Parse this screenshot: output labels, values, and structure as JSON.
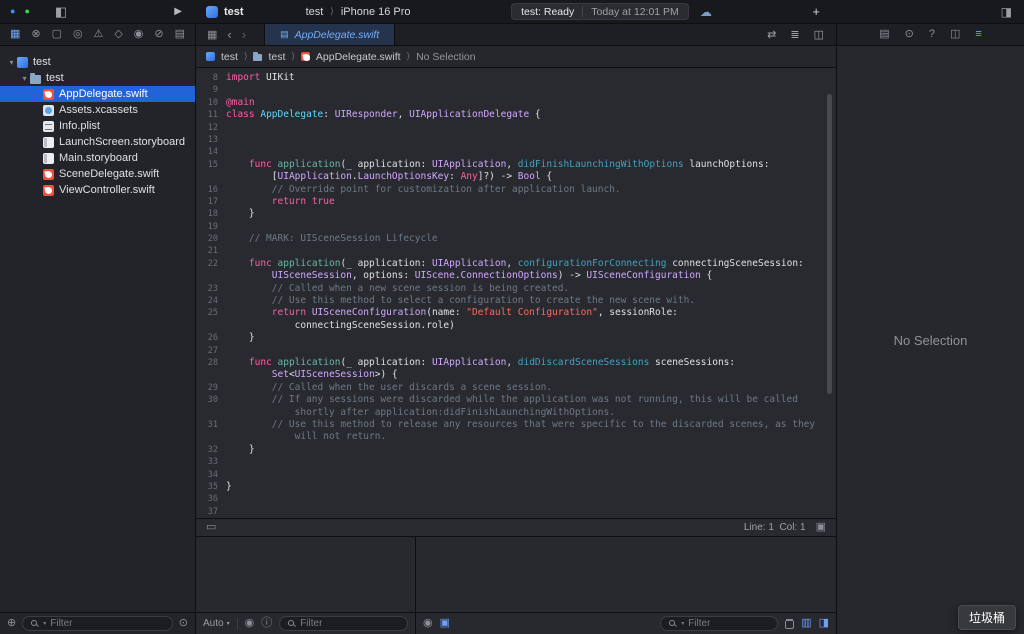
{
  "icons": {
    "dot_blue": "●",
    "dot_green": "●",
    "sidebar_toggle": "◧",
    "play": "▶",
    "chevron": "⟩",
    "back": "‹",
    "forward": "›",
    "grid": "▦",
    "doc": "▤",
    "swap": "⇄",
    "list_lines": "≣",
    "split_editor": "◫",
    "cloud": "☁",
    "plus": "+",
    "panel_right": "◨",
    "plus_circle": "⊕",
    "recent_clock": "⊙",
    "eye": "◉",
    "info": "ⓘ",
    "console_icon": "▣",
    "panel_bottom": "▥",
    "panel_side": "◨",
    "dropdown_arrow": "▾",
    "statusbar_left": "▭",
    "statusbar_right": "▣",
    "disclosure_open": "▾"
  },
  "titlebar": {
    "app_indicator": "test",
    "scheme_project": "test",
    "scheme_device": "iPhone 16 Pro",
    "status_primary": "test: Ready",
    "status_secondary": "Today at 12:01 PM"
  },
  "navigator_strip": [
    {
      "name": "project-navigator",
      "glyph": "▦",
      "active": true
    },
    {
      "name": "source-control-navigator",
      "glyph": "⊗",
      "active": false
    },
    {
      "name": "bookmarks-navigator",
      "glyph": "▢",
      "active": false
    },
    {
      "name": "find-navigator",
      "glyph": "◎",
      "active": false
    },
    {
      "name": "issues-navigator",
      "glyph": "⚠",
      "active": false
    },
    {
      "name": "tests-navigator",
      "glyph": "◇",
      "active": false
    },
    {
      "name": "debug-navigator",
      "glyph": "◉",
      "active": false
    },
    {
      "name": "breakpoints-navigator",
      "glyph": "⊘",
      "active": false
    },
    {
      "name": "reports-navigator",
      "glyph": "▤",
      "active": false
    }
  ],
  "inspector_strip": [
    {
      "name": "file-inspector",
      "glyph": "▤",
      "active": false
    },
    {
      "name": "history-inspector",
      "glyph": "⊙",
      "active": false
    },
    {
      "name": "quick-help-inspector",
      "glyph": "?",
      "active": false
    },
    {
      "name": "accessibility-inspector",
      "glyph": "◫",
      "active": false
    },
    {
      "name": "attributes-inspector",
      "glyph": "≡",
      "active": true
    }
  ],
  "navigator": {
    "filter_placeholder": "Filter",
    "items": [
      {
        "label": "test",
        "type": "project",
        "level": 0,
        "expanded": true,
        "selected": false
      },
      {
        "label": "test",
        "type": "folder",
        "level": 1,
        "expanded": true,
        "selected": false
      },
      {
        "label": "AppDelegate.swift",
        "type": "swift",
        "level": 2,
        "selected": true
      },
      {
        "label": "Assets.xcassets",
        "type": "assets",
        "level": 2,
        "selected": false
      },
      {
        "label": "Info.plist",
        "type": "plist",
        "level": 2,
        "selected": false
      },
      {
        "label": "LaunchScreen.storyboard",
        "type": "storyboard",
        "level": 2,
        "selected": false
      },
      {
        "label": "Main.storyboard",
        "type": "storyboard",
        "level": 2,
        "selected": false
      },
      {
        "label": "SceneDelegate.swift",
        "type": "swift",
        "level": 2,
        "selected": false
      },
      {
        "label": "ViewController.swift",
        "type": "swift",
        "level": 2,
        "selected": false
      }
    ]
  },
  "editor": {
    "tab_label": "AppDelegate.swift",
    "breadcrumb": [
      {
        "label": "test",
        "icon": "project",
        "dim": false
      },
      {
        "label": "test",
        "icon": "folder",
        "dim": false
      },
      {
        "label": "AppDelegate.swift",
        "icon": "swift",
        "dim": false
      },
      {
        "label": "No Selection",
        "icon": "",
        "dim": true
      }
    ],
    "statusbar_text": "Line: 1  Col: 1",
    "lines": [
      {
        "num": "8",
        "indent": 0,
        "segs": [
          [
            "k",
            "import"
          ],
          [
            "p",
            " UIKit"
          ]
        ]
      },
      {
        "num": "9",
        "indent": 0,
        "segs": []
      },
      {
        "num": "10",
        "indent": 0,
        "segs": [
          [
            "k",
            "@main"
          ]
        ]
      },
      {
        "num": "11",
        "indent": 0,
        "segs": [
          [
            "k",
            "class"
          ],
          [
            "p",
            " "
          ],
          [
            "d",
            "AppDelegate"
          ],
          [
            "p",
            ": "
          ],
          [
            "t",
            "UIResponder"
          ],
          [
            "p",
            ", "
          ],
          [
            "t",
            "UIApplicationDelegate"
          ],
          [
            "p",
            " {"
          ]
        ]
      },
      {
        "num": "12",
        "indent": 0,
        "segs": []
      },
      {
        "num": "13",
        "indent": 0,
        "segs": []
      },
      {
        "num": "14",
        "indent": 0,
        "segs": []
      },
      {
        "num": "15",
        "indent": 1,
        "segs": [
          [
            "k",
            "func"
          ],
          [
            "p",
            " "
          ],
          [
            "f",
            "application"
          ],
          [
            "p",
            "(_ application: "
          ],
          [
            "t",
            "UIApplication"
          ],
          [
            "p",
            ", "
          ],
          [
            "a",
            "didFinishLaunchingWithOptions"
          ],
          [
            "p",
            " launchOptions:"
          ]
        ]
      },
      {
        "num": "",
        "indent": 2,
        "segs": [
          [
            "p",
            "["
          ],
          [
            "t",
            "UIApplication"
          ],
          [
            "p",
            "."
          ],
          [
            "t",
            "LaunchOptionsKey"
          ],
          [
            "p",
            ": "
          ],
          [
            "k",
            "Any"
          ],
          [
            "p",
            "]?) -> "
          ],
          [
            "t",
            "Bool"
          ],
          [
            "p",
            " {"
          ]
        ]
      },
      {
        "num": "16",
        "indent": 2,
        "segs": [
          [
            "c",
            "// Override point for customization after application launch."
          ]
        ]
      },
      {
        "num": "17",
        "indent": 2,
        "segs": [
          [
            "k",
            "return"
          ],
          [
            "p",
            " "
          ],
          [
            "k",
            "true"
          ]
        ]
      },
      {
        "num": "18",
        "indent": 1,
        "segs": [
          [
            "p",
            "}"
          ]
        ]
      },
      {
        "num": "19",
        "indent": 0,
        "segs": []
      },
      {
        "num": "20",
        "indent": 1,
        "segs": [
          [
            "c",
            "// MARK: UISceneSession Lifecycle"
          ]
        ]
      },
      {
        "num": "21",
        "indent": 0,
        "segs": []
      },
      {
        "num": "22",
        "indent": 1,
        "segs": [
          [
            "k",
            "func"
          ],
          [
            "p",
            " "
          ],
          [
            "f",
            "application"
          ],
          [
            "p",
            "(_ application: "
          ],
          [
            "t",
            "UIApplication"
          ],
          [
            "p",
            ", "
          ],
          [
            "a",
            "configurationForConnecting"
          ],
          [
            "p",
            " connectingSceneSession:"
          ]
        ]
      },
      {
        "num": "",
        "indent": 2,
        "segs": [
          [
            "t",
            "UISceneSession"
          ],
          [
            "p",
            ", options: "
          ],
          [
            "t",
            "UIScene"
          ],
          [
            "p",
            "."
          ],
          [
            "t",
            "ConnectionOptions"
          ],
          [
            "p",
            ") -> "
          ],
          [
            "t",
            "UISceneConfiguration"
          ],
          [
            "p",
            " {"
          ]
        ]
      },
      {
        "num": "23",
        "indent": 2,
        "segs": [
          [
            "c",
            "// Called when a new scene session is being created."
          ]
        ]
      },
      {
        "num": "24",
        "indent": 2,
        "segs": [
          [
            "c",
            "// Use this method to select a configuration to create the new scene with."
          ]
        ]
      },
      {
        "num": "25",
        "indent": 2,
        "segs": [
          [
            "k",
            "return"
          ],
          [
            "p",
            " "
          ],
          [
            "t",
            "UISceneConfiguration"
          ],
          [
            "p",
            "(name: "
          ],
          [
            "s",
            "\"Default Configuration\""
          ],
          [
            "p",
            ", sessionRole:"
          ]
        ]
      },
      {
        "num": "",
        "indent": 3,
        "segs": [
          [
            "p",
            "connectingSceneSession.role)"
          ]
        ]
      },
      {
        "num": "26",
        "indent": 1,
        "segs": [
          [
            "p",
            "}"
          ]
        ]
      },
      {
        "num": "27",
        "indent": 0,
        "segs": []
      },
      {
        "num": "28",
        "indent": 1,
        "segs": [
          [
            "k",
            "func"
          ],
          [
            "p",
            " "
          ],
          [
            "f",
            "application"
          ],
          [
            "p",
            "(_ application: "
          ],
          [
            "t",
            "UIApplication"
          ],
          [
            "p",
            ", "
          ],
          [
            "a",
            "didDiscardSceneSessions"
          ],
          [
            "p",
            " sceneSessions:"
          ]
        ]
      },
      {
        "num": "",
        "indent": 2,
        "segs": [
          [
            "t",
            "Set"
          ],
          [
            "p",
            "<"
          ],
          [
            "t",
            "UISceneSession"
          ],
          [
            "p",
            ">) {"
          ]
        ]
      },
      {
        "num": "29",
        "indent": 2,
        "segs": [
          [
            "c",
            "// Called when the user discards a scene session."
          ]
        ]
      },
      {
        "num": "30",
        "indent": 2,
        "segs": [
          [
            "c",
            "// If any sessions were discarded while the application was not running, this will be called"
          ]
        ]
      },
      {
        "num": "",
        "indent": 3,
        "segs": [
          [
            "c",
            "shortly after application:didFinishLaunchingWithOptions."
          ]
        ]
      },
      {
        "num": "31",
        "indent": 2,
        "segs": [
          [
            "c",
            "// Use this method to release any resources that were specific to the discarded scenes, as they"
          ]
        ]
      },
      {
        "num": "",
        "indent": 3,
        "segs": [
          [
            "c",
            "will not return."
          ]
        ]
      },
      {
        "num": "32",
        "indent": 1,
        "segs": [
          [
            "p",
            "}"
          ]
        ]
      },
      {
        "num": "33",
        "indent": 0,
        "segs": []
      },
      {
        "num": "34",
        "indent": 0,
        "segs": []
      },
      {
        "num": "35",
        "indent": 0,
        "segs": [
          [
            "p",
            "}"
          ]
        ]
      },
      {
        "num": "36",
        "indent": 0,
        "segs": []
      },
      {
        "num": "37",
        "indent": 0,
        "segs": []
      }
    ]
  },
  "debug": {
    "auto_label": "Auto",
    "variables_filter_placeholder": "Filter",
    "console_filter_placeholder": "Filter"
  },
  "inspector": {
    "no_selection": "No Selection"
  },
  "ime": {
    "text": "垃圾桶"
  }
}
